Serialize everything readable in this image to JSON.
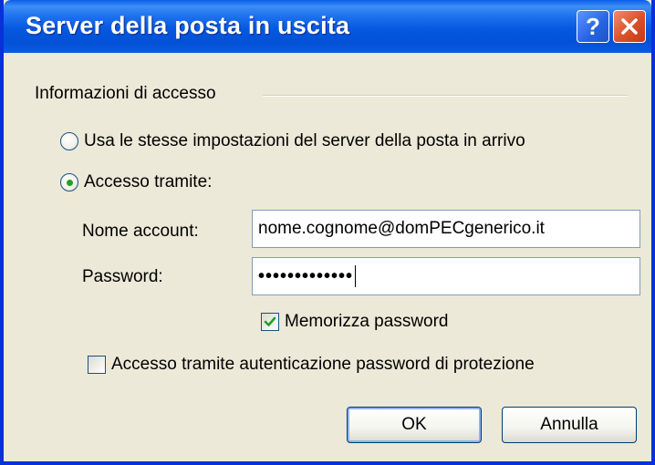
{
  "window": {
    "title": "Server della posta in uscita",
    "help_glyph": "?",
    "close_glyph": "✕"
  },
  "group": {
    "label": "Informazioni di accesso"
  },
  "options": {
    "same_settings_label": "Usa le stesse impostazioni del server della posta in arrivo",
    "same_settings_selected": false,
    "login_using_label": "Accesso tramite:",
    "login_using_selected": true
  },
  "account": {
    "name_label": "Nome account:",
    "name_value": "nome.cognome@domPECgenerico.it",
    "password_label": "Password:",
    "password_value": "•••••••••••••"
  },
  "remember": {
    "label": "Memorizza password",
    "checked": true
  },
  "spa": {
    "label": "Accesso tramite autenticazione password di protezione",
    "checked": false
  },
  "buttons": {
    "ok": "OK",
    "cancel": "Annulla"
  },
  "colors": {
    "titlebar": "#0558e0",
    "check": "#21a121",
    "close": "#d9512a"
  }
}
